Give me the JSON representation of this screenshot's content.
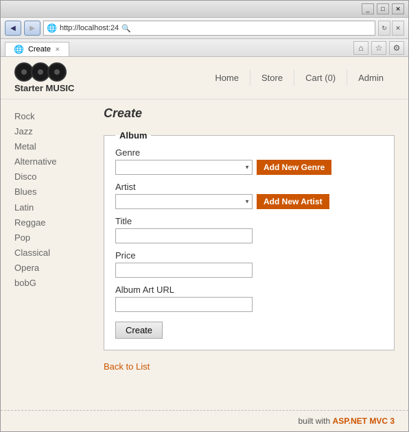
{
  "window": {
    "title": "Create",
    "title_bar_buttons": [
      "_",
      "□",
      "✕"
    ]
  },
  "address_bar": {
    "url": "http://localhost:24",
    "tab_label": "Create"
  },
  "site": {
    "title": "Starter MUSIC",
    "nav": [
      {
        "label": "Home"
      },
      {
        "label": "Store"
      },
      {
        "label": "Cart (0)"
      },
      {
        "label": "Admin"
      }
    ]
  },
  "sidebar": {
    "links": [
      "Rock",
      "Jazz",
      "Metal",
      "Alternative",
      "Disco",
      "Blues",
      "Latin",
      "Reggae",
      "Pop",
      "Classical",
      "Opera",
      "bobG"
    ]
  },
  "page": {
    "heading": "Create",
    "form": {
      "legend": "Album",
      "fields": [
        {
          "id": "genre",
          "label": "Genre",
          "type": "select",
          "add_btn": "Add New Genre"
        },
        {
          "id": "artist",
          "label": "Artist",
          "type": "select",
          "add_btn": "Add New Artist"
        },
        {
          "id": "title",
          "label": "Title",
          "type": "text"
        },
        {
          "id": "price",
          "label": "Price",
          "type": "text"
        },
        {
          "id": "album_art_url",
          "label": "Album Art URL",
          "type": "text"
        }
      ],
      "submit_label": "Create"
    },
    "back_link": "Back to List"
  },
  "footer": {
    "text": "built with ",
    "highlight": "ASP.NET MVC 3"
  }
}
